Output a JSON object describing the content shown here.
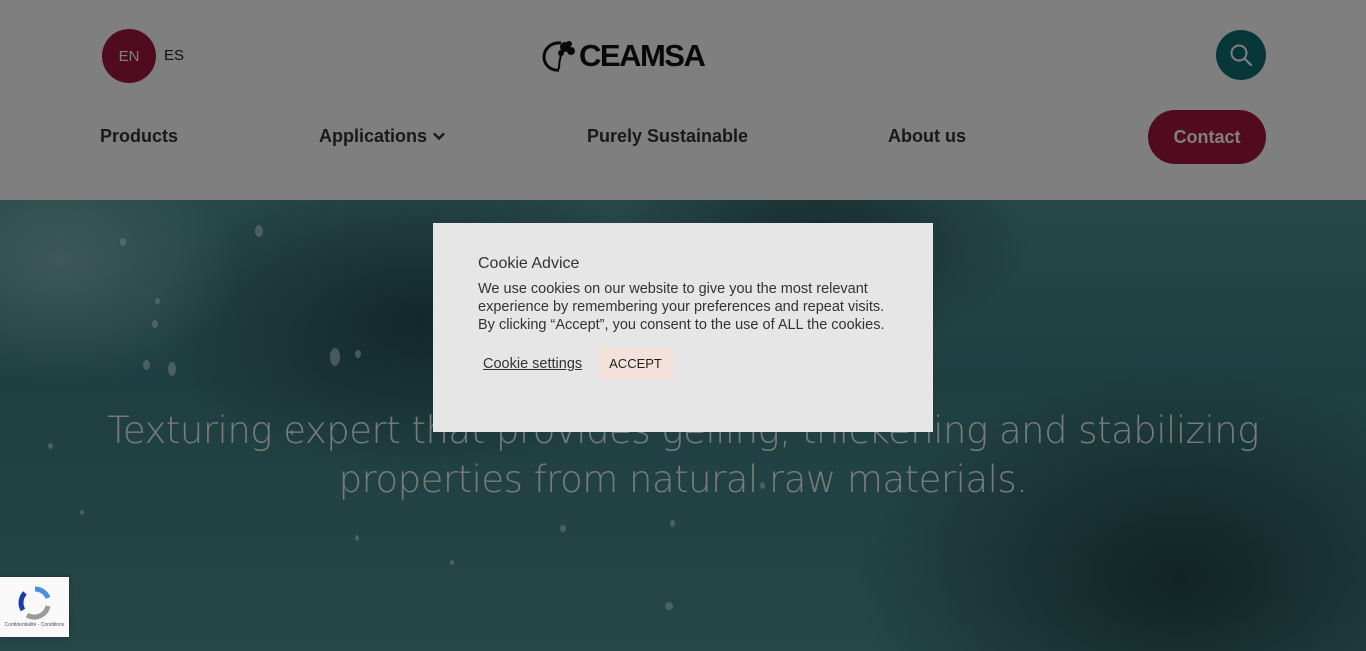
{
  "header": {
    "languages": [
      "EN",
      "ES"
    ],
    "brand": "CEAMSA",
    "nav": [
      {
        "label": "Products",
        "dropdown": false
      },
      {
        "label": "Applications",
        "dropdown": true
      },
      {
        "label": "Purely Sustainable",
        "dropdown": false
      },
      {
        "label": "About us",
        "dropdown": false
      }
    ],
    "contact_label": "Contact",
    "icons": {
      "search": "search-icon",
      "dropdown": "chevron-down-icon"
    }
  },
  "hero": {
    "line1": "Texturing expert that provides gelling, thickening and stabilizing",
    "line2": "properties from natural raw materials."
  },
  "cookie": {
    "title": "Cookie Advice",
    "body": "We use cookies on our website to give you the most relevant experience by remembering your preferences and repeat visits. By clicking “Accept”, you consent to the use of ALL the cookies.",
    "settings_label": "Cookie settings",
    "accept_label": "ACCEPT"
  },
  "recaptcha": {
    "links": "Confidentialité - Conditions"
  },
  "colors": {
    "brand": "#a0193d",
    "search": "#0e6f72",
    "accept_bg": "#f3e2dc"
  }
}
